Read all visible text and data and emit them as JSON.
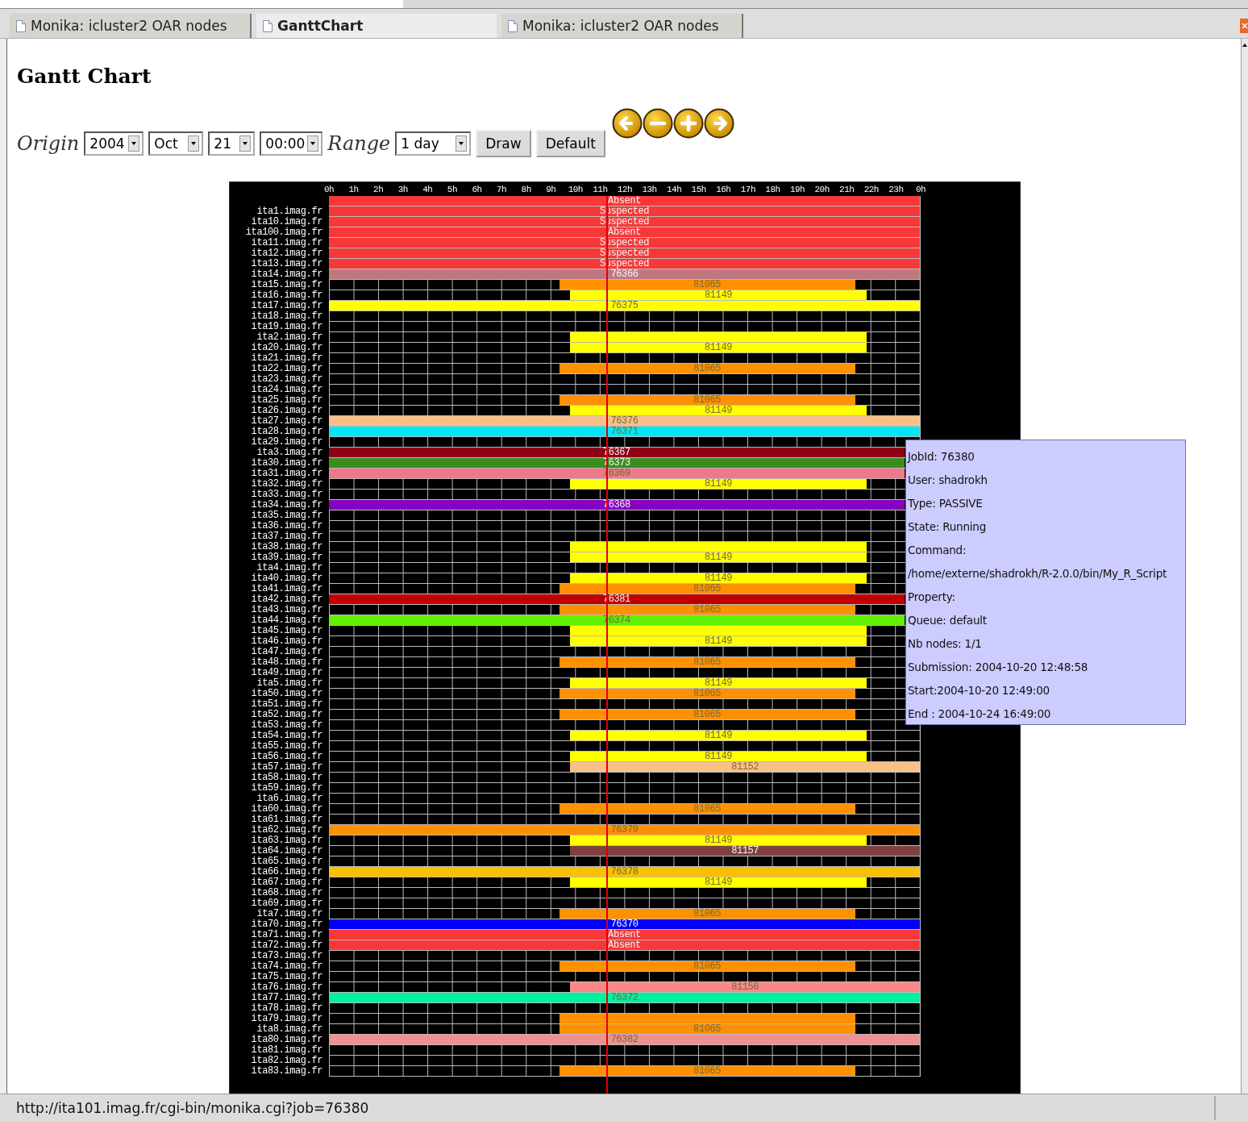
{
  "tabs": [
    {
      "label": "Monika: icluster2 OAR nodes",
      "selected": false
    },
    {
      "label": "GanttChart",
      "selected": true
    },
    {
      "label": "Monika: icluster2 OAR nodes",
      "selected": false
    }
  ],
  "title": "Gantt Chart",
  "controls": {
    "origin_label": "Origin",
    "year": "2004",
    "month": "Oct",
    "day": "21",
    "time": "00:00",
    "range_label": "Range",
    "range": "1 day",
    "buttons": [
      "Draw",
      "Default"
    ],
    "nav": [
      {
        "kind": "left"
      },
      {
        "kind": "minus"
      },
      {
        "kind": "plus"
      },
      {
        "kind": "right"
      }
    ]
  },
  "gantt": {
    "hours": [
      "0h",
      "1h",
      "2h",
      "3h",
      "4h",
      "5h",
      "6h",
      "7h",
      "8h",
      "9h",
      "10h",
      "11h",
      "12h",
      "13h",
      "14h",
      "15h",
      "16h",
      "17h",
      "18h",
      "19h",
      "20h",
      "21h",
      "22h",
      "23h",
      "0h"
    ],
    "now_marker": true,
    "rows": [
      {
        "bar": {
          "kind": "full",
          "color": "#f83838",
          "label": "Absent"
        }
      },
      {
        "node": "ita1.imag.fr",
        "bar": {
          "kind": "full",
          "color": "#f83838",
          "label": "Suspected"
        }
      },
      {
        "node": "ita10.imag.fr",
        "bar": {
          "kind": "full",
          "color": "#f83838",
          "label": "Suspected"
        }
      },
      {
        "node": "ita100.imag.fr",
        "bar": {
          "kind": "full",
          "color": "#f83838",
          "label": "Absent"
        }
      },
      {
        "node": "ita11.imag.fr",
        "bar": {
          "kind": "full",
          "color": "#f83838",
          "label": "Suspected"
        }
      },
      {
        "node": "ita12.imag.fr",
        "bar": {
          "kind": "full",
          "color": "#f83838",
          "label": "Suspected"
        }
      },
      {
        "node": "ita13.imag.fr",
        "bar": {
          "kind": "full",
          "color": "#f83838",
          "label": "Suspected"
        }
      },
      {
        "node": "ita14.imag.fr",
        "bar": {
          "kind": "full",
          "color": "#c07880",
          "label": "76366"
        }
      },
      {
        "node": "ita15.imag.fr",
        "bar": {
          "kind": "early",
          "color": "#ff9000",
          "label": "81065"
        }
      },
      {
        "node": "ita16.imag.fr",
        "bar": {
          "kind": "late",
          "color": "#ffff00",
          "label": "81149"
        }
      },
      {
        "node": "ita17.imag.fr",
        "bar": {
          "kind": "full",
          "color": "#ffff00",
          "label": "76375"
        }
      },
      {
        "node": "ita18.imag.fr"
      },
      {
        "node": "ita19.imag.fr"
      },
      {
        "node": "ita2.imag.fr",
        "bar": {
          "kind": "late",
          "color": "#ffff00"
        }
      },
      {
        "node": "ita20.imag.fr",
        "bar": {
          "kind": "late",
          "color": "#ffff00",
          "label": "81149"
        }
      },
      {
        "node": "ita21.imag.fr"
      },
      {
        "node": "ita22.imag.fr",
        "bar": {
          "kind": "early",
          "color": "#ff9000",
          "label": "81065"
        }
      },
      {
        "node": "ita23.imag.fr"
      },
      {
        "node": "ita24.imag.fr"
      },
      {
        "node": "ita25.imag.fr",
        "bar": {
          "kind": "early",
          "color": "#ff9000",
          "label": "81065"
        }
      },
      {
        "node": "ita26.imag.fr",
        "bar": {
          "kind": "late",
          "color": "#ffff00",
          "label": "81149"
        }
      },
      {
        "node": "ita27.imag.fr",
        "bar": {
          "kind": "full",
          "color": "#f8c088",
          "label": "76376"
        }
      },
      {
        "node": "ita28.imag.fr",
        "bar": {
          "kind": "full",
          "color": "#00e8f8",
          "label": "76371"
        }
      },
      {
        "node": "ita29.imag.fr"
      },
      {
        "node": "ita3.imag.fr",
        "bar": {
          "kind": "full",
          "color": "#900018",
          "label": "76367"
        }
      },
      {
        "node": "ita30.imag.fr",
        "bar": {
          "kind": "full",
          "color": "#3c8c20",
          "label": "76373"
        }
      },
      {
        "node": "ita31.imag.fr",
        "bar": {
          "kind": "full",
          "color": "#f07888",
          "label": "76369"
        }
      },
      {
        "node": "ita32.imag.fr",
        "bar": {
          "kind": "late",
          "color": "#ffff00",
          "label": "81149"
        }
      },
      {
        "node": "ita33.imag.fr"
      },
      {
        "node": "ita34.imag.fr",
        "bar": {
          "kind": "full",
          "color": "#8800c0",
          "label": "76368"
        }
      },
      {
        "node": "ita35.imag.fr"
      },
      {
        "node": "ita36.imag.fr"
      },
      {
        "node": "ita37.imag.fr"
      },
      {
        "node": "ita38.imag.fr",
        "bar": {
          "kind": "late",
          "color": "#ffff00"
        }
      },
      {
        "node": "ita39.imag.fr",
        "bar": {
          "kind": "late",
          "color": "#ffff00",
          "label": "81149"
        }
      },
      {
        "node": "ita4.imag.fr"
      },
      {
        "node": "ita40.imag.fr",
        "bar": {
          "kind": "late",
          "color": "#ffff00",
          "label": "81149"
        }
      },
      {
        "node": "ita41.imag.fr",
        "bar": {
          "kind": "early",
          "color": "#ff9000",
          "label": "81065"
        }
      },
      {
        "node": "ita42.imag.fr",
        "bar": {
          "kind": "full",
          "color": "#c00000",
          "label": "76381"
        }
      },
      {
        "node": "ita43.imag.fr",
        "bar": {
          "kind": "early",
          "color": "#ff9000",
          "label": "81065"
        }
      },
      {
        "node": "ita44.imag.fr",
        "bar": {
          "kind": "full",
          "color": "#60f000",
          "label": "76374"
        }
      },
      {
        "node": "ita45.imag.fr",
        "bar": {
          "kind": "late",
          "color": "#ffff00"
        }
      },
      {
        "node": "ita46.imag.fr",
        "bar": {
          "kind": "late",
          "color": "#ffff00",
          "label": "81149"
        }
      },
      {
        "node": "ita47.imag.fr"
      },
      {
        "node": "ita48.imag.fr",
        "bar": {
          "kind": "early",
          "color": "#ff9000",
          "label": "81065"
        }
      },
      {
        "node": "ita49.imag.fr"
      },
      {
        "node": "ita5.imag.fr",
        "bar": {
          "kind": "late",
          "color": "#ffff00",
          "label": "81149"
        }
      },
      {
        "node": "ita50.imag.fr",
        "bar": {
          "kind": "early",
          "color": "#ff9000",
          "label": "81065"
        }
      },
      {
        "node": "ita51.imag.fr"
      },
      {
        "node": "ita52.imag.fr",
        "bar": {
          "kind": "early",
          "color": "#ff9000",
          "label": "81065"
        }
      },
      {
        "node": "ita53.imag.fr"
      },
      {
        "node": "ita54.imag.fr",
        "bar": {
          "kind": "late",
          "color": "#ffff00",
          "label": "81149"
        }
      },
      {
        "node": "ita55.imag.fr"
      },
      {
        "node": "ita56.imag.fr",
        "bar": {
          "kind": "late",
          "color": "#ffff00",
          "label": "81149"
        }
      },
      {
        "node": "ita57.imag.fr",
        "bar": {
          "kind": "tail",
          "color": "#f8c088",
          "label": "81152"
        }
      },
      {
        "node": "ita58.imag.fr"
      },
      {
        "node": "ita59.imag.fr"
      },
      {
        "node": "ita6.imag.fr"
      },
      {
        "node": "ita60.imag.fr",
        "bar": {
          "kind": "early",
          "color": "#ff9000",
          "label": "81065"
        }
      },
      {
        "node": "ita61.imag.fr"
      },
      {
        "node": "ita62.imag.fr",
        "bar": {
          "kind": "full",
          "color": "#ff9000",
          "label": "76379"
        }
      },
      {
        "node": "ita63.imag.fr",
        "bar": {
          "kind": "late",
          "color": "#ffff00",
          "label": "81149"
        }
      },
      {
        "node": "ita64.imag.fr",
        "bar": {
          "kind": "tail",
          "color": "#804040",
          "label": "81157"
        }
      },
      {
        "node": "ita65.imag.fr"
      },
      {
        "node": "ita66.imag.fr",
        "bar": {
          "kind": "full",
          "color": "#f8c000",
          "label": "76378"
        }
      },
      {
        "node": "ita67.imag.fr",
        "bar": {
          "kind": "late",
          "color": "#ffff00",
          "label": "81149"
        }
      },
      {
        "node": "ita68.imag.fr"
      },
      {
        "node": "ita69.imag.fr"
      },
      {
        "node": "ita7.imag.fr",
        "bar": {
          "kind": "early",
          "color": "#ff9000",
          "label": "81065"
        }
      },
      {
        "node": "ita70.imag.fr",
        "bar": {
          "kind": "full",
          "color": "#0000f8",
          "label": "76370"
        }
      },
      {
        "node": "ita71.imag.fr",
        "bar": {
          "kind": "full",
          "color": "#f83838",
          "label": "Absent"
        }
      },
      {
        "node": "ita72.imag.fr",
        "bar": {
          "kind": "full",
          "color": "#f83838",
          "label": "Absent"
        }
      },
      {
        "node": "ita73.imag.fr"
      },
      {
        "node": "ita74.imag.fr",
        "bar": {
          "kind": "early",
          "color": "#ff9000",
          "label": "81065"
        }
      },
      {
        "node": "ita75.imag.fr"
      },
      {
        "node": "ita76.imag.fr",
        "bar": {
          "kind": "tail",
          "color": "#f88888",
          "label": "81156"
        }
      },
      {
        "node": "ita77.imag.fr",
        "bar": {
          "kind": "full",
          "color": "#00f0a0",
          "label": "76372"
        }
      },
      {
        "node": "ita78.imag.fr"
      },
      {
        "node": "ita79.imag.fr",
        "bar": {
          "kind": "early",
          "color": "#ff9000"
        }
      },
      {
        "node": "ita8.imag.fr",
        "bar": {
          "kind": "early",
          "color": "#ff9000",
          "label": "81065"
        }
      },
      {
        "node": "ita80.imag.fr",
        "bar": {
          "kind": "full",
          "color": "#f09090",
          "label": "76382"
        }
      },
      {
        "node": "ita81.imag.fr"
      },
      {
        "node": "ita82.imag.fr"
      },
      {
        "node": "ita83.imag.fr",
        "bar": {
          "kind": "early",
          "color": "#ff9000",
          "label": "81065"
        }
      }
    ]
  },
  "tooltip": {
    "lines": [
      "JobId: 76380",
      "User: shadrokh",
      "Type: PASSIVE",
      "State: Running",
      "Command:",
      "/home/externe/shadrokh/R-2.0.0/bin/My_R_Script",
      "Property:",
      "Queue: default",
      "Nb nodes: 1/1",
      "Submission: 2004-10-20 12:48:58",
      "Start:2004-10-20 12:49:00",
      "End : 2004-10-24 16:49:00"
    ]
  },
  "status_bar": "http://ita101.imag.fr/cgi-bin/monika.cgi?job=76380"
}
